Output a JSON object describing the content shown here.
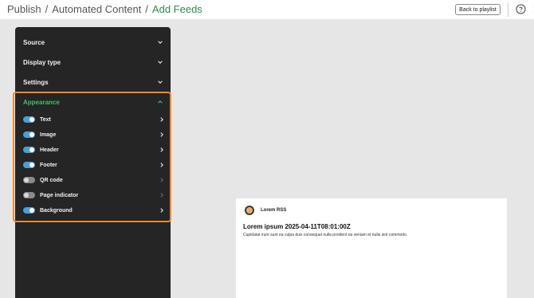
{
  "header": {
    "breadcrumb": [
      "Publish",
      "Automated Content",
      "Add Feeds"
    ],
    "separator": "/",
    "back_button": "Back to playlist",
    "help_icon": "help-circle-icon",
    "more_icon": "more-vertical-icon"
  },
  "panel": {
    "sections": [
      {
        "label": "Source",
        "expanded": false
      },
      {
        "label": "Display type",
        "expanded": false
      },
      {
        "label": "Settings",
        "expanded": false
      },
      {
        "label": "Appearance",
        "expanded": true
      }
    ],
    "appearance_items": [
      {
        "label": "Text",
        "enabled": true
      },
      {
        "label": "Image",
        "enabled": true
      },
      {
        "label": "Header",
        "enabled": true
      },
      {
        "label": "Footer",
        "enabled": true
      },
      {
        "label": "QR code",
        "enabled": false
      },
      {
        "label": "Page indicator",
        "enabled": false
      },
      {
        "label": "Background",
        "enabled": true
      }
    ]
  },
  "preview": {
    "feed_name": "Lorem RSS",
    "title": "Lorem ipsum 2025-04-11T08:01:00Z",
    "body": "Cupidatat irure sunt ea culpa duis consequat nulla proident ea veniam et nulla sint commodo."
  },
  "colors": {
    "accent_orange": "#f08a2a",
    "active_green": "#3fbf6a",
    "toggle_on": "#4a9fd8",
    "panel_bg": "#252525"
  }
}
